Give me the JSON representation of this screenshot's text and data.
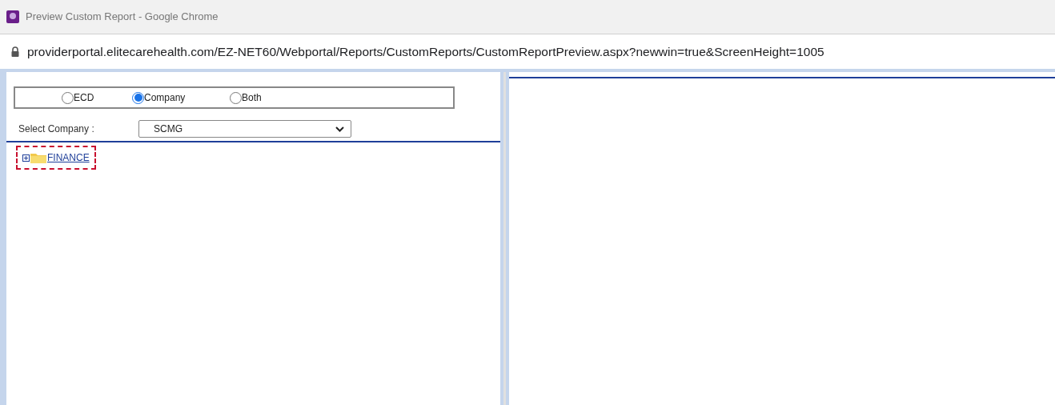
{
  "window": {
    "title": "Preview Custom Report - Google Chrome"
  },
  "address_bar": {
    "url": "providerportal.elitecarehealth.com/EZ-NET60/Webportal/Reports/CustomReports/CustomReportPreview.aspx?newwin=true&ScreenHeight=1005"
  },
  "source_options": [
    {
      "label": "ECD",
      "selected": false
    },
    {
      "label": "Company",
      "selected": true
    },
    {
      "label": "Both",
      "selected": false
    }
  ],
  "company_select": {
    "label": "Select Company :",
    "value": "SCMG"
  },
  "tree": [
    {
      "label": "FINANCE",
      "expanded": false,
      "selected": true
    }
  ]
}
